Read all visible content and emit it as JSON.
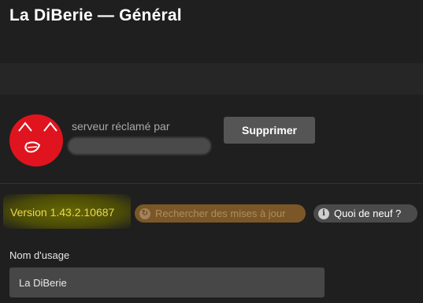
{
  "header": {
    "title": "La DiBerie — Général"
  },
  "claim": {
    "avatar_icon": "server-avatar-icon",
    "claimed_by_label": "serveur réclamé par",
    "delete_button_label": "Supprimer"
  },
  "version": {
    "label": "Version 1.43.2.10687",
    "check_updates_label": "Rechercher des mises à jour",
    "check_updates_icon": "refresh-icon",
    "whats_new_label": "Quoi de neuf ?",
    "whats_new_icon": "info-icon"
  },
  "usage_name": {
    "label": "Nom d'usage",
    "value": "La DiBerie"
  },
  "colors": {
    "background": "#1f1f1f",
    "accent_orange": "#8c6129",
    "version_text": "#e8d84a",
    "avatar_red": "#e0141e"
  }
}
